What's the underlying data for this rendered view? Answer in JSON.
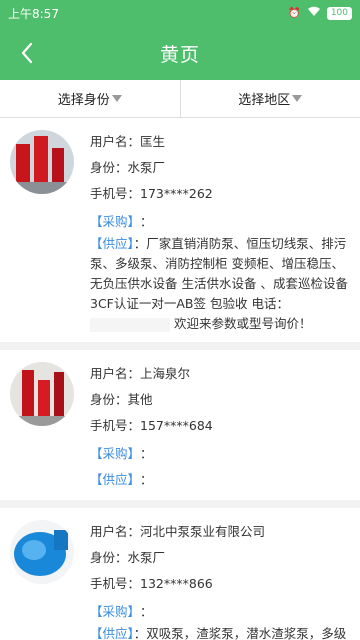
{
  "status_bar": {
    "time": "上午8:57",
    "battery": "100"
  },
  "header": {
    "title": "黄页"
  },
  "filters": [
    {
      "label": "选择身份"
    },
    {
      "label": "选择地区"
    }
  ],
  "labels": {
    "username": "用户名：",
    "identity": "身份：",
    "phone": "手机号：",
    "purchase": "【采购】",
    "supply": "【供应】",
    "colon": "："
  },
  "items": [
    {
      "username": "匡生",
      "identity": "水泵厂",
      "phone": "173****262",
      "purchase": "",
      "supply": "厂家直销消防泵、恒压切线泵、排污泵、多级泵、消防控制柜 变频柜、增压稳压、无负压供水设备 生活供水设备 、成套巡检设备 3CF认证一对一AB签 包验收 电话：",
      "supply_tail": "欢迎来参数或型号询价！"
    },
    {
      "username": "上海泉尔",
      "identity": "其他",
      "phone": "157****684",
      "purchase": "",
      "supply": ""
    },
    {
      "username": "河北中泵泵业有限公司",
      "identity": "水泵厂",
      "phone": "132****866",
      "purchase": "",
      "supply": "双吸泵，渣浆泵，潜水渣浆泵，多级泵，压滤机入料泵"
    }
  ],
  "colors": {
    "header": "#4fbe6c",
    "tag": "#3b8de0"
  }
}
